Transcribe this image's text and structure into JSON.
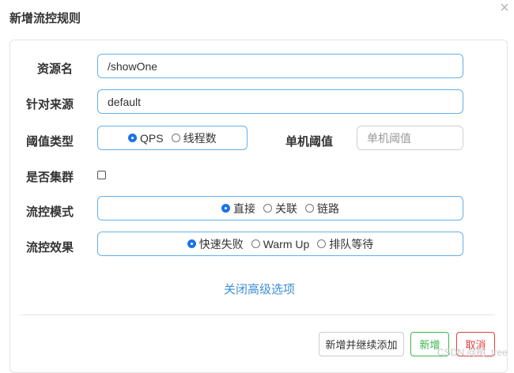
{
  "dialog": {
    "title": "新增流控规则"
  },
  "form": {
    "resource": {
      "label": "资源名",
      "value": "/showOne"
    },
    "limit_app": {
      "label": "针对来源",
      "value": "default"
    },
    "threshold_type": {
      "label": "阈值类型",
      "options": [
        "QPS",
        "线程数"
      ],
      "selected": "QPS"
    },
    "single_threshold": {
      "label": "单机阈值",
      "placeholder": "单机阈值",
      "value": ""
    },
    "cluster": {
      "label": "是否集群",
      "checked": false
    },
    "control_mode": {
      "label": "流控模式",
      "options": [
        "直接",
        "关联",
        "链路"
      ],
      "selected": "直接"
    },
    "control_effect": {
      "label": "流控效果",
      "options": [
        "快速失败",
        "Warm Up",
        "排队等待"
      ],
      "selected": "快速失败"
    }
  },
  "advanced_link": "关闭高级选项",
  "buttons": {
    "add_continue": "新增并继续添加",
    "add": "新增",
    "cancel": "取消"
  },
  "watermark": "CSDN @树_tree",
  "colors": {
    "accent_blue": "#1a73e8",
    "link_blue": "#3d8fd6",
    "add_green": "#3bb54a",
    "cancel_red": "#e04040"
  }
}
